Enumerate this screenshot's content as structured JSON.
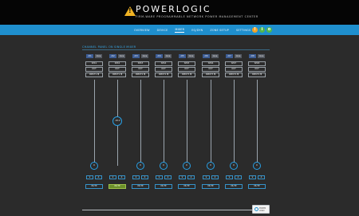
{
  "header": {
    "logo_mark": "!",
    "logo_text": "POWERLOGIC",
    "tagline": "FIRM-WARE PROGRAMMABLE NETWORK POWER MANAGEMENT CENTER"
  },
  "nav": {
    "items": [
      "OVERVIEW",
      "DEVICE",
      "MIXER",
      "EQ/DYN",
      "ZONE SETUP",
      "SETTINGS"
    ],
    "active_index": 2,
    "status_circles": [
      {
        "name": "alert-icon",
        "glyph": "!",
        "color": "#f3a326"
      },
      {
        "name": "info-icon",
        "glyph": "i",
        "color": "#52b84c"
      },
      {
        "name": "power-icon",
        "glyph": "o",
        "color": "#52b84c"
      }
    ]
  },
  "section": {
    "title": "CHANNEL PANEL ON SINGLE MIXER"
  },
  "channels": [
    {
      "tag_l": "ch1",
      "tag_r": "zone",
      "name": "SPK1",
      "mode": "OUT",
      "input": "INPUT1 ▼",
      "level": 0,
      "level_label": "0",
      "mute": "MUTE",
      "muted": false
    },
    {
      "tag_l": "ch2",
      "tag_r": "zone",
      "name": "SPK2",
      "mode": "OUT",
      "input": "INPUT1 ▼",
      "level": 0.48,
      "level_label": "-18.0",
      "mute": "MUTE",
      "muted": true
    },
    {
      "tag_l": "ch3",
      "tag_r": "zone",
      "name": "SPK3",
      "mode": "OUT",
      "input": "INPUT2 ▼",
      "level": 0,
      "level_label": "0",
      "mute": "MUTE",
      "muted": false
    },
    {
      "tag_l": "ch4",
      "tag_r": "zone",
      "name": "SPK4",
      "mode": "OUT",
      "input": "INPUT2 ▼",
      "level": 0,
      "level_label": "0",
      "mute": "MUTE",
      "muted": false
    },
    {
      "tag_l": "ch5",
      "tag_r": "zone",
      "name": "SPK5",
      "mode": "OUT",
      "input": "INPUT3 ▼",
      "level": 0,
      "level_label": "0",
      "mute": "MUTE",
      "muted": false
    },
    {
      "tag_l": "ch6",
      "tag_r": "zone",
      "name": "SPK6",
      "mode": "OUT",
      "input": "INPUT3 ▼",
      "level": 0,
      "level_label": "0",
      "mute": "MUTE",
      "muted": false
    },
    {
      "tag_l": "ch7",
      "tag_r": "zone",
      "name": "SPK7",
      "mode": "OUT",
      "input": "INPUT4 ▼",
      "level": 0,
      "level_label": "0",
      "mute": "MUTE",
      "muted": false
    },
    {
      "tag_l": "ch8",
      "tag_r": "zone",
      "name": "SPK8",
      "mode": "OUT",
      "input": "INPUT4 ▼",
      "level": 0,
      "level_label": "0",
      "mute": "MUTE",
      "muted": false
    }
  ],
  "controls": {
    "down_glyph": "∨",
    "up_glyph": "∧"
  },
  "footer": {
    "logo_text": "POWER LOGIC"
  },
  "colors": {
    "accent": "#1f8fce",
    "background": "#2b2b2b",
    "mute_active": "#6b8f2a"
  }
}
